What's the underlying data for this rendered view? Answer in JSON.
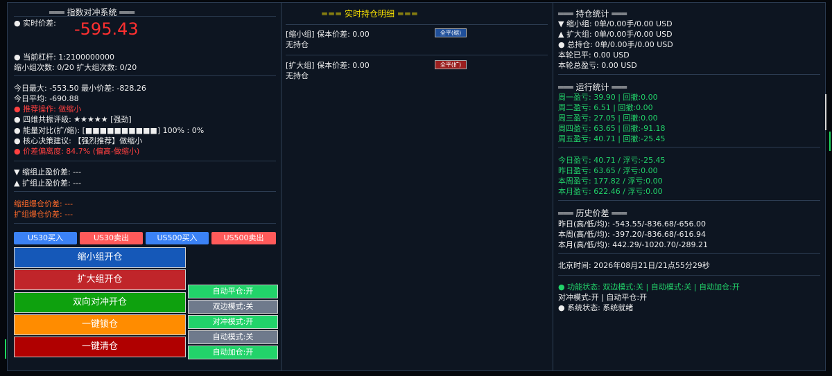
{
  "left": {
    "title": "═══ 指数对冲系统 ═══",
    "realtime_label": "实时价差:",
    "realtime_value": "-595.43",
    "leverage": "当前杠杆:      1:2100000000",
    "counts": "缩小组次数: 0/20      扩大组次数: 0/20",
    "today_max": "今日最大: -553.50     最小价差: -828.26",
    "today_avg": "今日平均: -690.88",
    "recommend": "推荐操作:     做缩小",
    "resonance": "四维共振评级:     ★★★★★ [强劲]",
    "energy": "能量对比(扩/缩):     [■■■■■■■■■■] 100% : 0%",
    "core": "核心决策建议:   【强烈推荐】做缩小",
    "deviation": "价差偏离度:    84.7% (偏高-做缩小)",
    "shrink_tp": "▼ 缩组止盈价差: ---",
    "expand_tp": "▲ 扩组止盈价差: ---",
    "shrink_liq": "缩组爆仓价差: ---",
    "expand_liq": "扩组爆仓价差: ---",
    "trade_buttons": [
      "US30买入",
      "US30卖出",
      "US500买入",
      "US500卖出"
    ],
    "big_buttons": [
      "缩小组开仓",
      "扩大组开仓",
      "双向对冲开仓",
      "一键锁仓",
      "一键清仓"
    ],
    "toggle_buttons": [
      "自动平仓:开",
      "双边模式:关",
      "对冲模式:开",
      "自动模式:关",
      "自动加仓:开"
    ]
  },
  "middle": {
    "title": "=== 实时持仓明细 ===",
    "shrink_header": "[缩小组] 保本价差:  0.00",
    "shrink_button": "全平(缩)",
    "shrink_status": "无持仓",
    "expand_header": "[扩大组] 保本价差:  0.00",
    "expand_button": "全平(扩)",
    "expand_status": "无持仓"
  },
  "right": {
    "pos_title": "═══ 持仓统计 ═══",
    "pos_rows": [
      "▼ 缩小组:      0单/0.00手/0.00 USD",
      "▲ 扩大组:      0单/0.00手/0.00 USD",
      "总持仓:       0单/0.00手/0.00 USD",
      "本轮已平:     0.00 USD",
      "本轮总盈亏:     0.00 USD"
    ],
    "run_title": "═══ 运行统计 ═══",
    "weekday_rows": [
      "周一盈亏:    39.90 | 回撤:0.00",
      "周二盈亏:    6.51 | 回撤:0.00",
      "周三盈亏:    27.05 | 回撤:0.00",
      "周四盈亏:    63.65 | 回撤:-91.18",
      "周五盈亏:    40.71 | 回撤:-25.45"
    ],
    "period_rows": [
      "今日盈亏:    40.71 / 浮亏:-25.45",
      "昨日盈亏:    63.65 / 浮亏:0.00",
      "本周盈亏:    177.82 / 浮亏:0.00",
      "本月盈亏:    622.46 / 浮亏:0.00"
    ],
    "hist_title": "═══ 历史价差 ═══",
    "hist_rows": [
      "昨日(高/低/均):      -543.55/-836.68/-656.00",
      "本周(高/低/均):      -397.20/-836.68/-616.94",
      "本月(高/低/均):      442.29/-1020.70/-289.21"
    ],
    "beijing_time": "北京时间:    2026年08月21日/21点55分29秒",
    "func_status": "功能状态:      双边模式:关 | 自动模式:关 | 自动加仓:开",
    "hedge_line": "对冲模式:开 | 自动平仓:开",
    "system_status": "系统状态:      系统就绪"
  },
  "colors": {
    "background": "#0d1521",
    "red": "#ff4040",
    "green": "#22d36a",
    "blue_button": "#3b82f6",
    "red_button": "#ff5a5a"
  }
}
